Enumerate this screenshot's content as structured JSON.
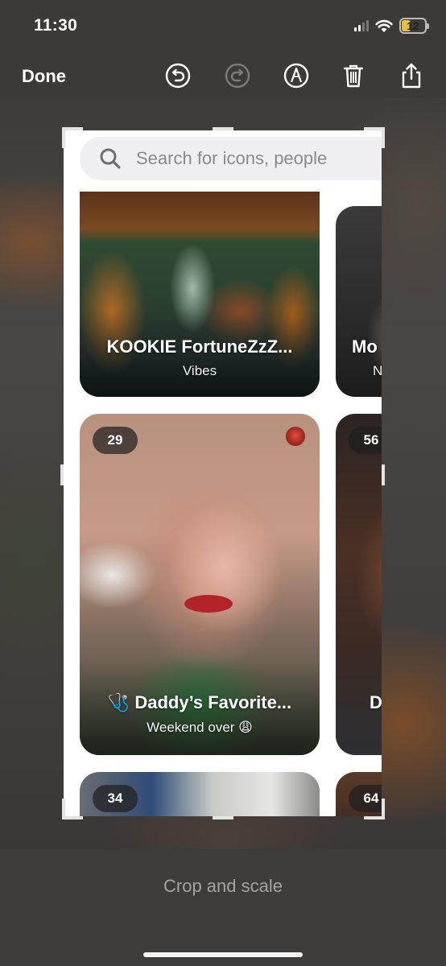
{
  "status": {
    "time": "11:30",
    "battery": "12"
  },
  "toolbar": {
    "done_label": "Done",
    "icons": [
      "undo-icon",
      "redo-icon",
      "markup-icon",
      "trash-icon",
      "share-icon"
    ]
  },
  "search": {
    "placeholder": "Search for icons, people"
  },
  "cards": [
    {
      "title": "KOOKIE FortuneZzZ...",
      "subtitle": "Vibes"
    },
    {
      "title": "Mo",
      "subtitle": "N"
    },
    {
      "count": "29",
      "title": "Daddy’s Favorite...",
      "subtitle": "Weekend over 😩"
    },
    {
      "count": "56",
      "title": "D"
    },
    {
      "count": "34"
    },
    {
      "count": "64"
    }
  ],
  "footer": {
    "caption": "Crop and scale"
  },
  "colors": {
    "accent_battery": "#e8c23b",
    "toolbar_bg": "#3c3a38",
    "bottom_bg": "#3e3c3b"
  }
}
